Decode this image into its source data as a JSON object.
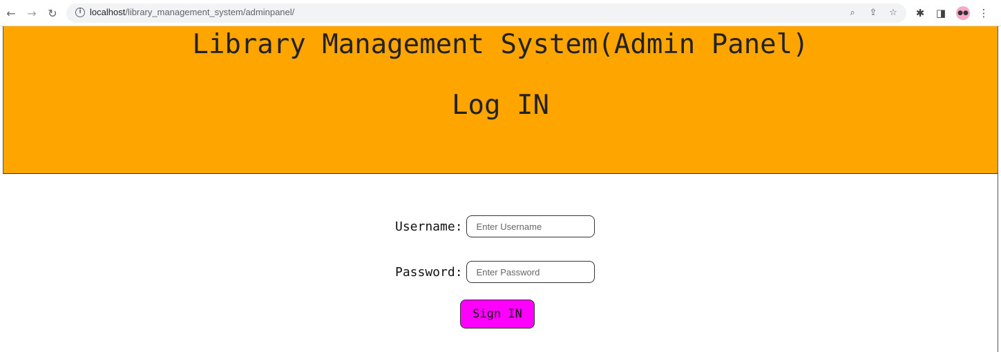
{
  "browser": {
    "url_host": "localhost",
    "url_path": "/library_management_system/adminpanel/",
    "icons": [
      "back-arrow-icon",
      "forward-arrow-icon",
      "reload-icon",
      "info-icon",
      "zoom-icon",
      "share-icon",
      "star-icon",
      "extensions-icon",
      "side-panel-icon",
      "profile-avatar-icon",
      "menu-icon"
    ]
  },
  "header": {
    "title": "Library Management System(Admin Panel)",
    "subtitle": "Log IN",
    "background": "#ffa500"
  },
  "form": {
    "username_label": "Username:",
    "username_placeholder": "Enter Username",
    "username_value": "",
    "password_label": "Password:",
    "password_placeholder": "Enter Password",
    "password_value": "",
    "submit_label": "Sign IN",
    "submit_color": "#ff00ff"
  }
}
